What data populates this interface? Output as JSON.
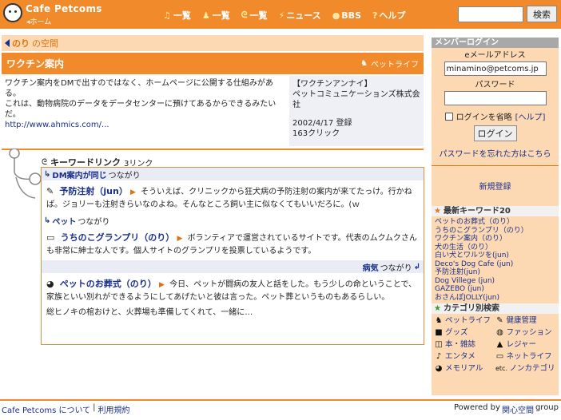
{
  "header": {
    "logo_text": "Cafe Petcoms",
    "home_label": "◂ホーム",
    "nav": [
      {
        "icon": "♫",
        "label": "一覧"
      },
      {
        "icon": "♟",
        "label": "一覧"
      },
      {
        "icon": "ᘓ",
        "label": "一覧"
      },
      {
        "icon": "⚡",
        "label": "ニュース"
      },
      {
        "icon": "●",
        "label": "BBS"
      },
      {
        "icon": "?",
        "label": "ヘルプ"
      }
    ],
    "search_placeholder": "",
    "search_button": "検索"
  },
  "breadcrumb": {
    "user": "◂",
    "title": "のり",
    "suffix": "の空間"
  },
  "page": {
    "title": "ワクチン案内",
    "category": "ペットライフ",
    "description": [
      "ワクチン案内をDMで出すのではなく、ホームページに公開する仕組みがある。",
      "これは、動物病院のデータをデータセンターに預けてあるからできるみたいだ。"
    ],
    "url": "http://www.ahmics.com/...",
    "meta": {
      "anchor": "【ワクチンアンナイ】",
      "company": "ペットコミュニケーションズ株式会社",
      "registered": "2002/4/17 登録",
      "clicks": "163クリック"
    }
  },
  "keyword_links": {
    "heading": "キーワードリンク",
    "count": "3リンク",
    "groups": [
      {
        "connection_label": "DM案内が同じ",
        "connection_suffix": "つながり",
        "title": "予防注射（jun）",
        "body": "そういえば、クリニックから狂犬病の予防注射の案内が来てたっけ。行かねば。ジョリーも注射きらいなのよね。そんなところ飼い主に似なくてもいいだろに。(ｗ"
      },
      {
        "connection_label": "ペット",
        "connection_suffix": "つながり",
        "title": "うちのこグランプリ（のり）",
        "body": "ボランティアで運営されているサイトです。代表のムクムクさんも非常に紳士な人です。個人サイトのグランプリを投票しているようです。"
      },
      {
        "connection_label": "病気",
        "connection_suffix": "つながり",
        "title": "ペットのお葬式（のり）",
        "body": "今日、ペットが闘病の友人と話をした。もう少しの命ということで、家族といい別れができるようにしてあげたいと彼は言った。ペット葬というものもあるらしい。",
        "body2": "総ヒノキの棺おけと、火葬場も準備してくれて、一緒に…"
      }
    ]
  },
  "sidebar": {
    "login_heading": "メンバーログイン",
    "email_label": "eメールアドレス",
    "email_value": "minamino@petcoms.jp",
    "password_label": "パスワード",
    "remember_label": "ログインを省略",
    "help_label": "[ヘルプ]",
    "login_button": "ログイン",
    "forgot_label": "パスワードを忘れた方はこちら",
    "register_label": "新規登録",
    "keywords_heading": "最新キーワード20",
    "keywords": [
      "ペットのお葬式（のり）",
      "うちのこグランプリ（のり）",
      "ワクチン案内（のり）",
      "犬の生活（のり）",
      "白い犬とワルツを(jun)",
      "Deco's Dog Cafe (jun)",
      "予防注射(jun)",
      "Dog Villege (jun)",
      "GAZEBO (jun)",
      "おさんぽJOLLY(jun)"
    ],
    "category_heading": "カテゴリ別検索",
    "categories": [
      {
        "icon": "♞",
        "label": "ペットライフ"
      },
      {
        "icon": "✎",
        "label": "健康管理"
      },
      {
        "icon": "■",
        "label": "グッズ"
      },
      {
        "icon": "◍",
        "label": "ファッション"
      },
      {
        "icon": "◫",
        "label": "本・雑誌"
      },
      {
        "icon": "▲",
        "label": "レジャー"
      },
      {
        "icon": "♪",
        "label": "エンタメ"
      },
      {
        "icon": "▭",
        "label": "ネットライフ"
      },
      {
        "icon": "◕",
        "label": "メモリアル"
      },
      {
        "icon": "etc.",
        "label": "ノンカテゴリ"
      }
    ]
  },
  "footer": {
    "about": "Cafe Petcoms について",
    "terms": "利用規約",
    "powered_prefix": "Powered by",
    "powered_link": "関心空間",
    "powered_suffix": "group"
  }
}
